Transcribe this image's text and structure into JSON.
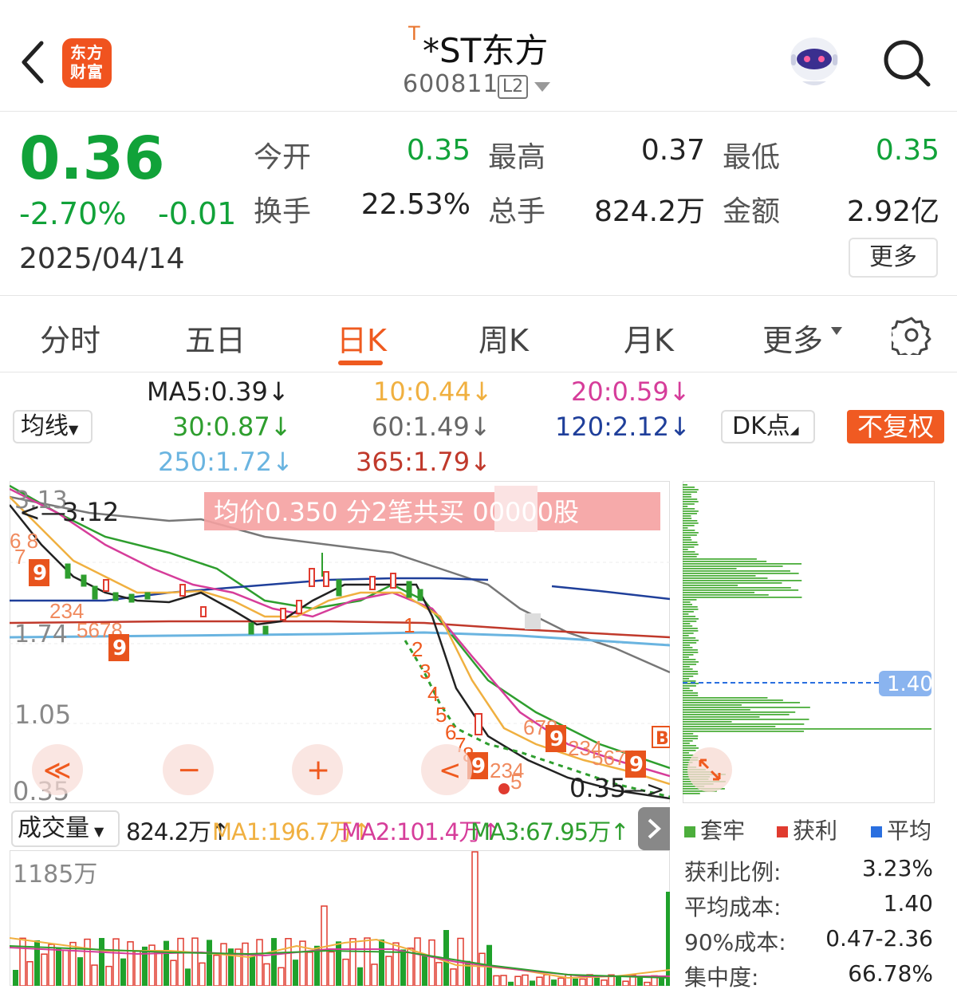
{
  "header": {
    "stock_flag": "T",
    "title": "*ST东方",
    "code": "600811",
    "level_badge": "L2",
    "logo_line1": "东方",
    "logo_line2": "财富",
    "icons": [
      "back-arrow-icon",
      "app-logo-icon",
      "robot-assistant-icon",
      "search-icon"
    ]
  },
  "quote": {
    "price": "0.36",
    "change_pct": "-2.70%",
    "change": "-0.01",
    "date": "2025/04/14",
    "fields": [
      {
        "label": "今开",
        "value": "0.35",
        "color": "#11a239"
      },
      {
        "label": "最高",
        "value": "0.37",
        "color": "#222222"
      },
      {
        "label": "最低",
        "value": "0.35",
        "color": "#11a239"
      },
      {
        "label": "换手",
        "value": "22.53%",
        "color": "#222222"
      },
      {
        "label": "总手",
        "value": "824.2万",
        "color": "#222222"
      },
      {
        "label": "金额",
        "value": "2.92亿",
        "color": "#222222"
      }
    ],
    "more_label": "更多"
  },
  "tabs": {
    "items": [
      "分时",
      "五日",
      "日K",
      "周K",
      "月K",
      "更多"
    ],
    "active": "日K"
  },
  "ma_legend": {
    "ma5": "MA5:0.39↓",
    "ma10": "10:0.44↓",
    "ma20": "20:0.59↓",
    "ma30": "30:0.87↓",
    "ma60": "60:1.49↓",
    "ma120": "120:2.12↓",
    "ma250": "250:1.72↓",
    "ma365": "365:1.79↓",
    "dropdown": "均线",
    "dk_label": "DK点",
    "fq_label": "不复权",
    "colors": {
      "ma5": "#222222",
      "ma10": "#f0b040",
      "ma20": "#d63d9a",
      "ma30": "#2e9e2e",
      "ma60": "#666666",
      "ma120": "#1f3f9a",
      "ma250": "#6ab4e0",
      "ma365": "#c0392b"
    }
  },
  "kchart": {
    "y_labels": [
      "3.13",
      "1.74",
      "1.05",
      "0.35"
    ],
    "max_marker": "3.12",
    "min_marker": "0.35",
    "banner": "均价0.350  分2笔共买      00000股",
    "signal_b": "B",
    "controls": [
      "≪",
      "−",
      "+",
      "<"
    ]
  },
  "volume_profile": {
    "avg_cost_marker": "1.40",
    "legend": [
      "套牢",
      "获利",
      "平均"
    ],
    "legend_colors": {
      "套牢": "#4cae3c",
      "获利": "#e03b2f",
      "平均": "#2a6fe0"
    },
    "stats": [
      {
        "label": "获利比例:",
        "value": "3.23%"
      },
      {
        "label": "平均成本:",
        "value": "1.40"
      },
      {
        "label": "90%成本:",
        "value": "0.47-2.36"
      },
      {
        "label": "集中度:",
        "value": "66.78%"
      }
    ]
  },
  "volume": {
    "dropdown": "成交量",
    "vol": "824.2万↑",
    "ma1": "MA1:196.7万↑",
    "ma2": "MA2:101.4万↑",
    "ma3": "MA3:67.95万↑",
    "y_max": "1185万"
  }
}
